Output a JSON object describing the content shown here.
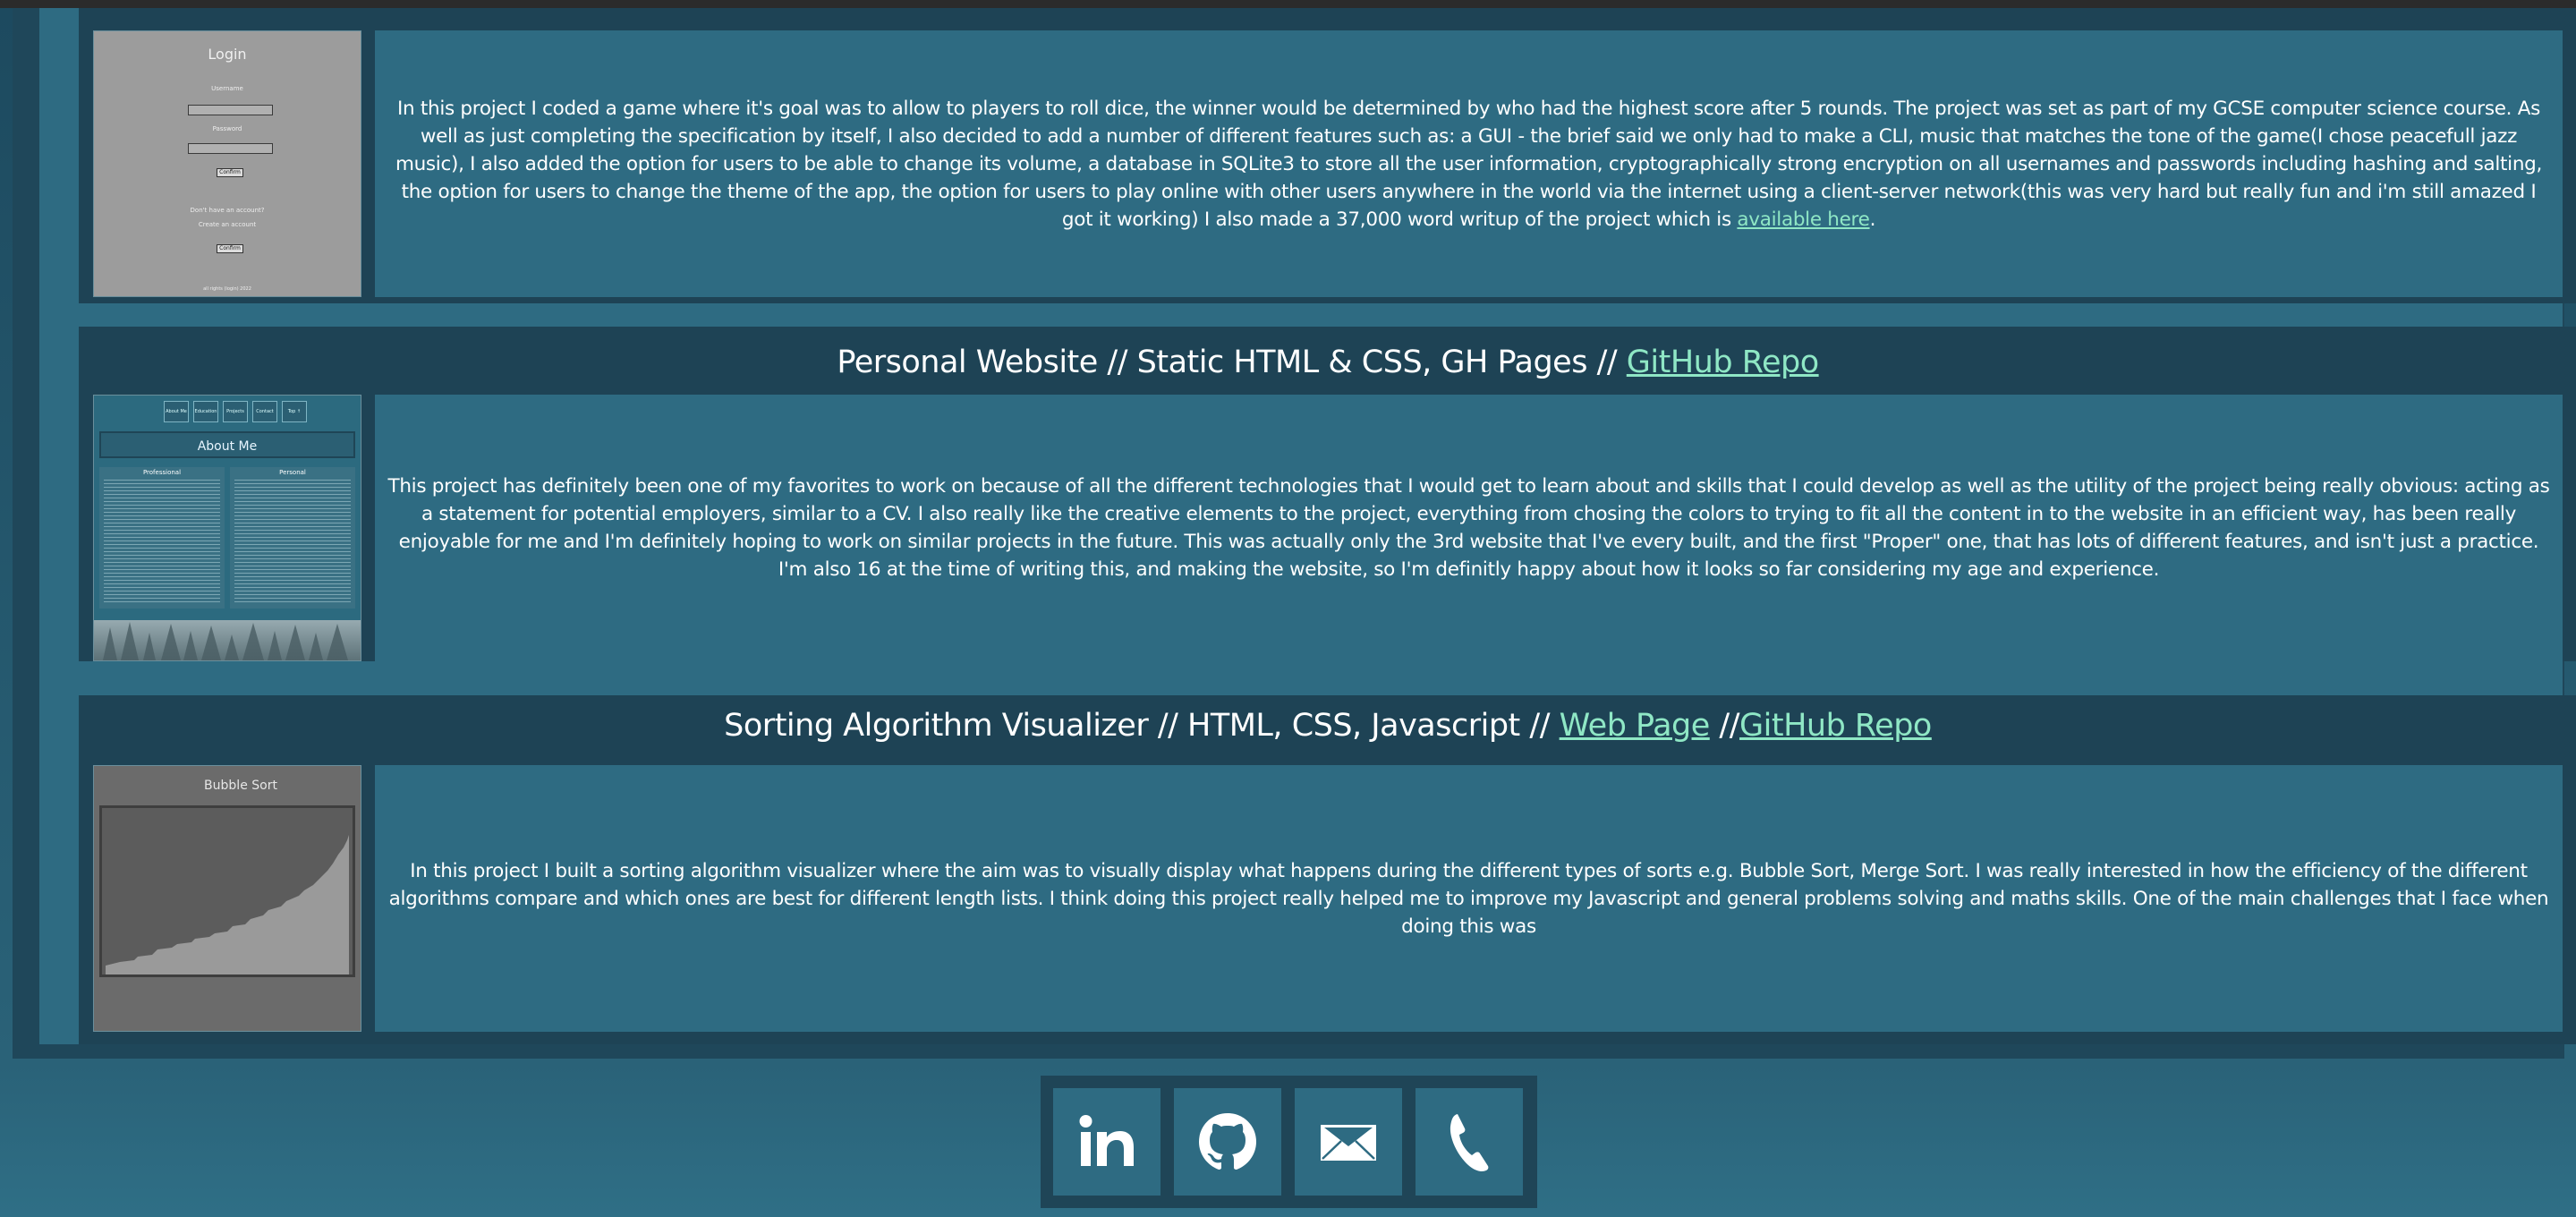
{
  "projects": [
    {
      "title_partial": "",
      "link_partial": "",
      "description_prefix": "In this project I coded a game where it's goal was to allow to players to roll dice, the winner would be determined by who had the highest score after 5 rounds. The project was set as part of my GCSE computer science course. As well as just completing the specification by itself, I also decided to add a number of different features such as: a GUI - the brief said we only had to make a CLI, music that matches the tone of the game(I chose peacefull jazz music), I also added the option for users to be able to change its volume, a database in SQLite3 to store all the user information, cryptographically strong encryption on all usernames and passwords including hashing and salting, the option for users to change the theme of the app, the option for users to play online with other users anywhere in the world via the internet using a client-server network(this was very hard but really fun and i'm still amazed I got it working) I also made a 37,000 word writup of the project which is ",
      "description_link": "available here",
      "description_suffix": ".",
      "thumbnail": {
        "title": "Login",
        "username_label": "Username",
        "password_label": "Password",
        "confirm_label": "Confirm",
        "no_account_text": "Don't have an account?",
        "create_text": "Create an account",
        "confirm2_label": "Confirm",
        "footer_text": "all rights (login) 2022"
      }
    },
    {
      "title_prefix": "Personal Website // Static HTML & CSS, GH Pages // ",
      "title_link": "GitHub Repo",
      "description": "This project has definitely been one of my favorites to work on because of all the different technologies that I would get to learn about and skills that I could develop as well as the utility of the project being really obvious: acting as a statement for potential employers, similar to a CV. I also really like the creative elements to the project, everything from chosing the colors to trying to fit all the content in to the website in an efficient way, has been really enjoyable for me and I'm definitely hoping to work on similar projects in the future. This was actually only the 3rd website that I've every built, and the first \"Proper\" one, that has lots of different features, and isn't just a practice. I'm also 16 at the time of writing this, and making the website, so I'm definitly happy about how it looks so far considering my age and experience.",
      "thumbnail": {
        "nav": [
          "About Me",
          "Education",
          "Projects",
          "Contact",
          "Top ↑"
        ],
        "heading": "About Me",
        "col_left": "Professional",
        "col_right": "Personal"
      }
    },
    {
      "title_prefix": "Sorting Algorithm Visualizer // HTML, CSS, Javascript // ",
      "title_link1": "Web Page",
      "title_mid": " //",
      "title_link2": "GitHub Repo",
      "description": "In this project I built a sorting algorithm visualizer where the aim was to visually display what happens during the different types of sorts e.g. Bubble Sort, Merge Sort. I was really interested in how the efficiency of the different algorithms compare and which ones are best for different length lists. I think doing this project really helped me to improve my Javascript and general problems solving and maths skills. One of the main challenges that I face when doing this was",
      "thumbnail": {
        "title": "Bubble Sort"
      }
    }
  ],
  "social": [
    {
      "name": "linkedin-icon"
    },
    {
      "name": "github-icon"
    },
    {
      "name": "email-icon"
    },
    {
      "name": "phone-icon"
    }
  ],
  "colors": {
    "background": "#2f6b81",
    "panel_dark": "#1e4355",
    "link": "#8fe7c5"
  }
}
